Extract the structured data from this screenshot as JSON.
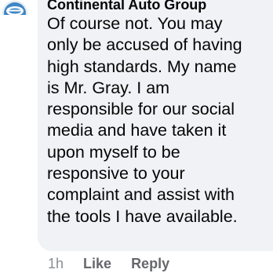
{
  "comment": {
    "author": "Continental Auto Group",
    "avatar_icon": "continental-auto-group-logo-icon",
    "lines": [
      "Of course not.  You may",
      "only be accused of having",
      "high standards. My name",
      "is Mr. Gray. I am",
      "responsible for our social",
      "media and have taken it",
      "upon myself to be",
      "responsive to your",
      "complaint and assist with",
      "the tools I have available."
    ],
    "timestamp": "1h",
    "like_label": "Like",
    "reply_label": "Reply"
  },
  "colors": {
    "bubble": "#f0f2f5",
    "text": "#050505",
    "action": "#65676b",
    "avatar_blue": "#3f86c6"
  }
}
